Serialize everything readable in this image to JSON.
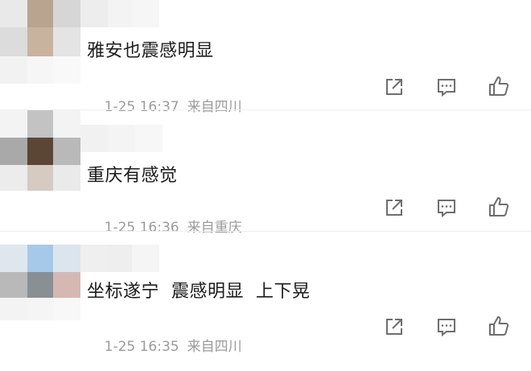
{
  "comments": [
    {
      "text": "雅安也震感明显",
      "time": "1-25 16:37",
      "location": "来自四川"
    },
    {
      "text": "重庆有感觉",
      "time": "1-25 16:36",
      "location": "来自重庆"
    },
    {
      "text": "坐标遂宁  震感明显  上下晃",
      "time": "1-25 16:35",
      "location": "来自四川"
    }
  ],
  "actions": [
    "share-icon",
    "comment-icon",
    "like-icon"
  ],
  "colors": {
    "text": "#1b1b1b",
    "meta": "#9b9b9b",
    "icon": "#6e6e6e"
  }
}
